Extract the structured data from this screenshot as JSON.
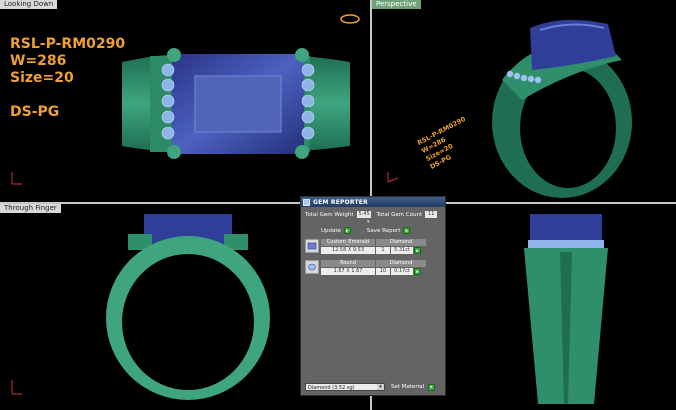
{
  "viewports": {
    "top_left": {
      "label": "Looking Down"
    },
    "top_right": {
      "label": "Perspective"
    },
    "bottom_left": {
      "label": "Through Finger"
    }
  },
  "ring_spec": {
    "line1": "RSL-P-RM0290",
    "line2": "W=286",
    "line3": "Size=20",
    "line4": "DS-PG"
  },
  "ring_engraving": {
    "line1": "RSL-P-RM0290",
    "line2": "W=286",
    "line3": "Size=20",
    "line4": "DS-PG"
  },
  "colors": {
    "metal": "#2f8f6a",
    "metal_light": "#5bc19a",
    "stone": "#3a4aa0",
    "stone_light": "#6f82d8",
    "accent_text": "#f0a030"
  },
  "gem_reporter": {
    "title": "GEM REPORTER",
    "total_weight_label": "Total Gem Weight",
    "total_weight_value": "5.45",
    "total_count_label": "Total Gem Count",
    "total_count_value": "11",
    "update_label": "Update",
    "save_report_label": "Save Report",
    "gems": [
      {
        "shape": "Custom_Emerald",
        "material": "Diamond",
        "size": "12.58 X 9.53",
        "count": "1",
        "weight": "5.31ct"
      },
      {
        "shape": "Round",
        "material": "Diamond",
        "size": "1.67 X 1.67",
        "count": "10",
        "weight": "0.17ct"
      }
    ],
    "material_select": "Diamond   (3.52 sg)",
    "set_material_label": "Set Material"
  }
}
